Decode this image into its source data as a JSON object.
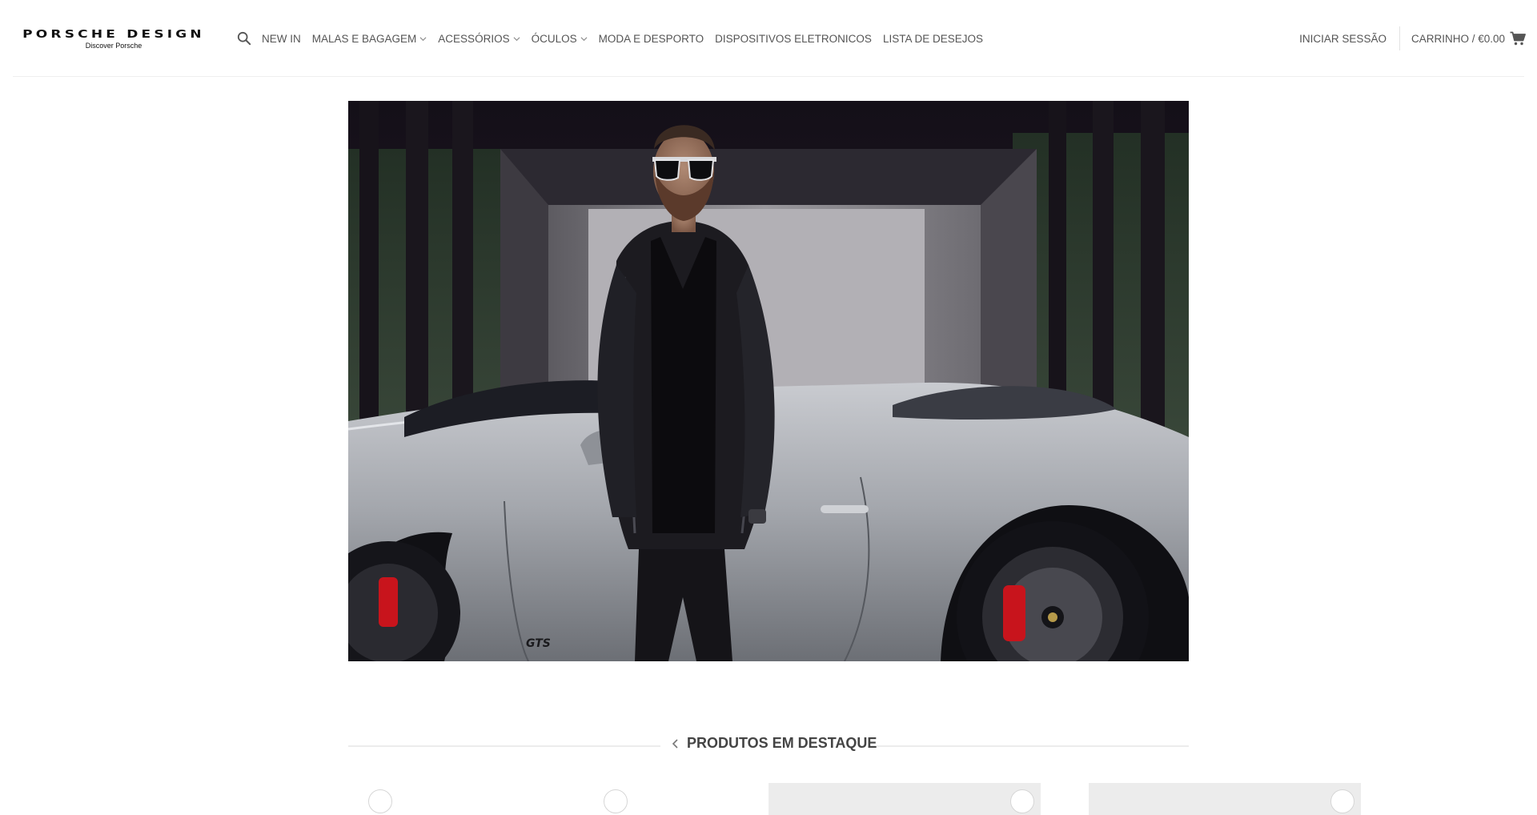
{
  "brand": {
    "logo_main": "PORSCHE DESIGN",
    "logo_sub": "Discover Porsche"
  },
  "nav": {
    "items": [
      {
        "label": "NEW IN",
        "has_dropdown": false
      },
      {
        "label": "MALAS E BAGAGEM",
        "has_dropdown": true
      },
      {
        "label": "ACESSÓRIOS",
        "has_dropdown": true
      },
      {
        "label": "ÓCULOS",
        "has_dropdown": true
      },
      {
        "label": "MODA E DESPORTO",
        "has_dropdown": false
      },
      {
        "label": "DISPOSITIVOS ELETRONICOS",
        "has_dropdown": false
      },
      {
        "label": "LISTA DE DESEJOS",
        "has_dropdown": false
      }
    ],
    "search_icon": "search-icon"
  },
  "account": {
    "login_label": "INICIAR SESSÃO",
    "cart_label": "CARRINHO / €0.00",
    "cart_icon": "shopping-cart-icon"
  },
  "hero": {
    "car_badge": "GTS"
  },
  "featured": {
    "title": "PRODUTOS EM DESTAQUE"
  },
  "colors": {
    "brake_red": "#c8141c",
    "nav_text": "#555555",
    "rule": "#ececec"
  }
}
